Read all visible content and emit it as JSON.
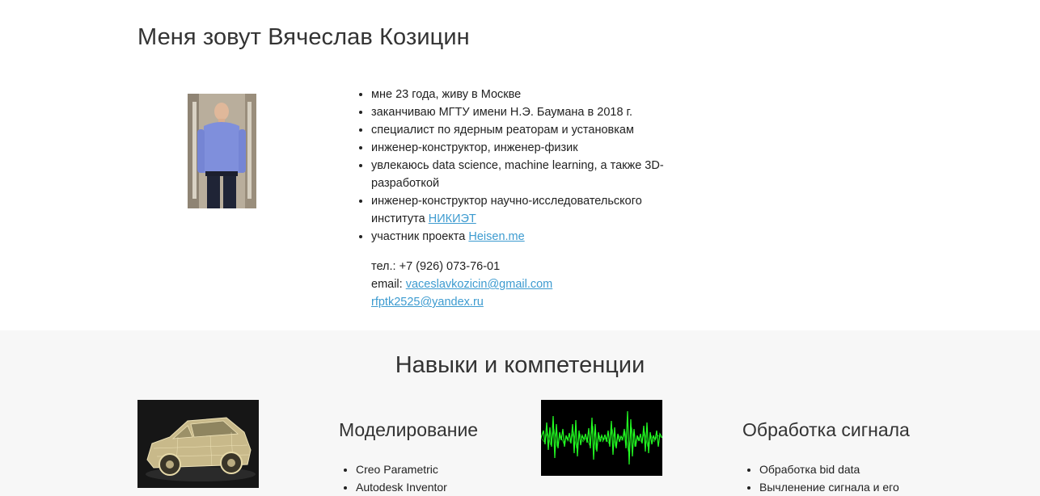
{
  "header": {
    "title": "Меня зовут Вячеслав Козицин"
  },
  "about": {
    "items": [
      {
        "text": "мне 23 года, живу в Москве"
      },
      {
        "text": "заканчиваю МГТУ имени Н.Э. Баумана в 2018 г."
      },
      {
        "text": "специалист по ядерным реаторам и установкам"
      },
      {
        "text": "инженер-конструктор, инженер-физик"
      },
      {
        "text": "увлекаюсь data science, machine learning, а также 3D-разработкой"
      },
      {
        "text": "инженер-конструктор научно-исследовательского института ",
        "link": "НИКИЭТ"
      },
      {
        "text": "участник проекта ",
        "link": "Heisen.me"
      }
    ],
    "phone": "тел.: +7 (926) 073-76-01",
    "email_label": "email: ",
    "email_primary": "vaceslavkozicin@gmail.com",
    "email_secondary": "rfptk2525@yandex.ru"
  },
  "skills": {
    "title": "Навыки и компетенции",
    "modeling": {
      "heading": "Моделирование",
      "items": [
        "Creo Parametric",
        "Autodesk Inventor"
      ]
    },
    "signal": {
      "heading": "Обработка сигнала",
      "items": [
        "Обработка bid data",
        "Вычленение сигнала и его"
      ]
    }
  },
  "colors": {
    "link": "#3d9bd0",
    "section_bg": "#f7f7f7",
    "waveform": "#22ff22"
  },
  "icons": {
    "photo": "profile-photo",
    "car": "car-wireframe-image",
    "wave": "signal-waveform-image"
  }
}
